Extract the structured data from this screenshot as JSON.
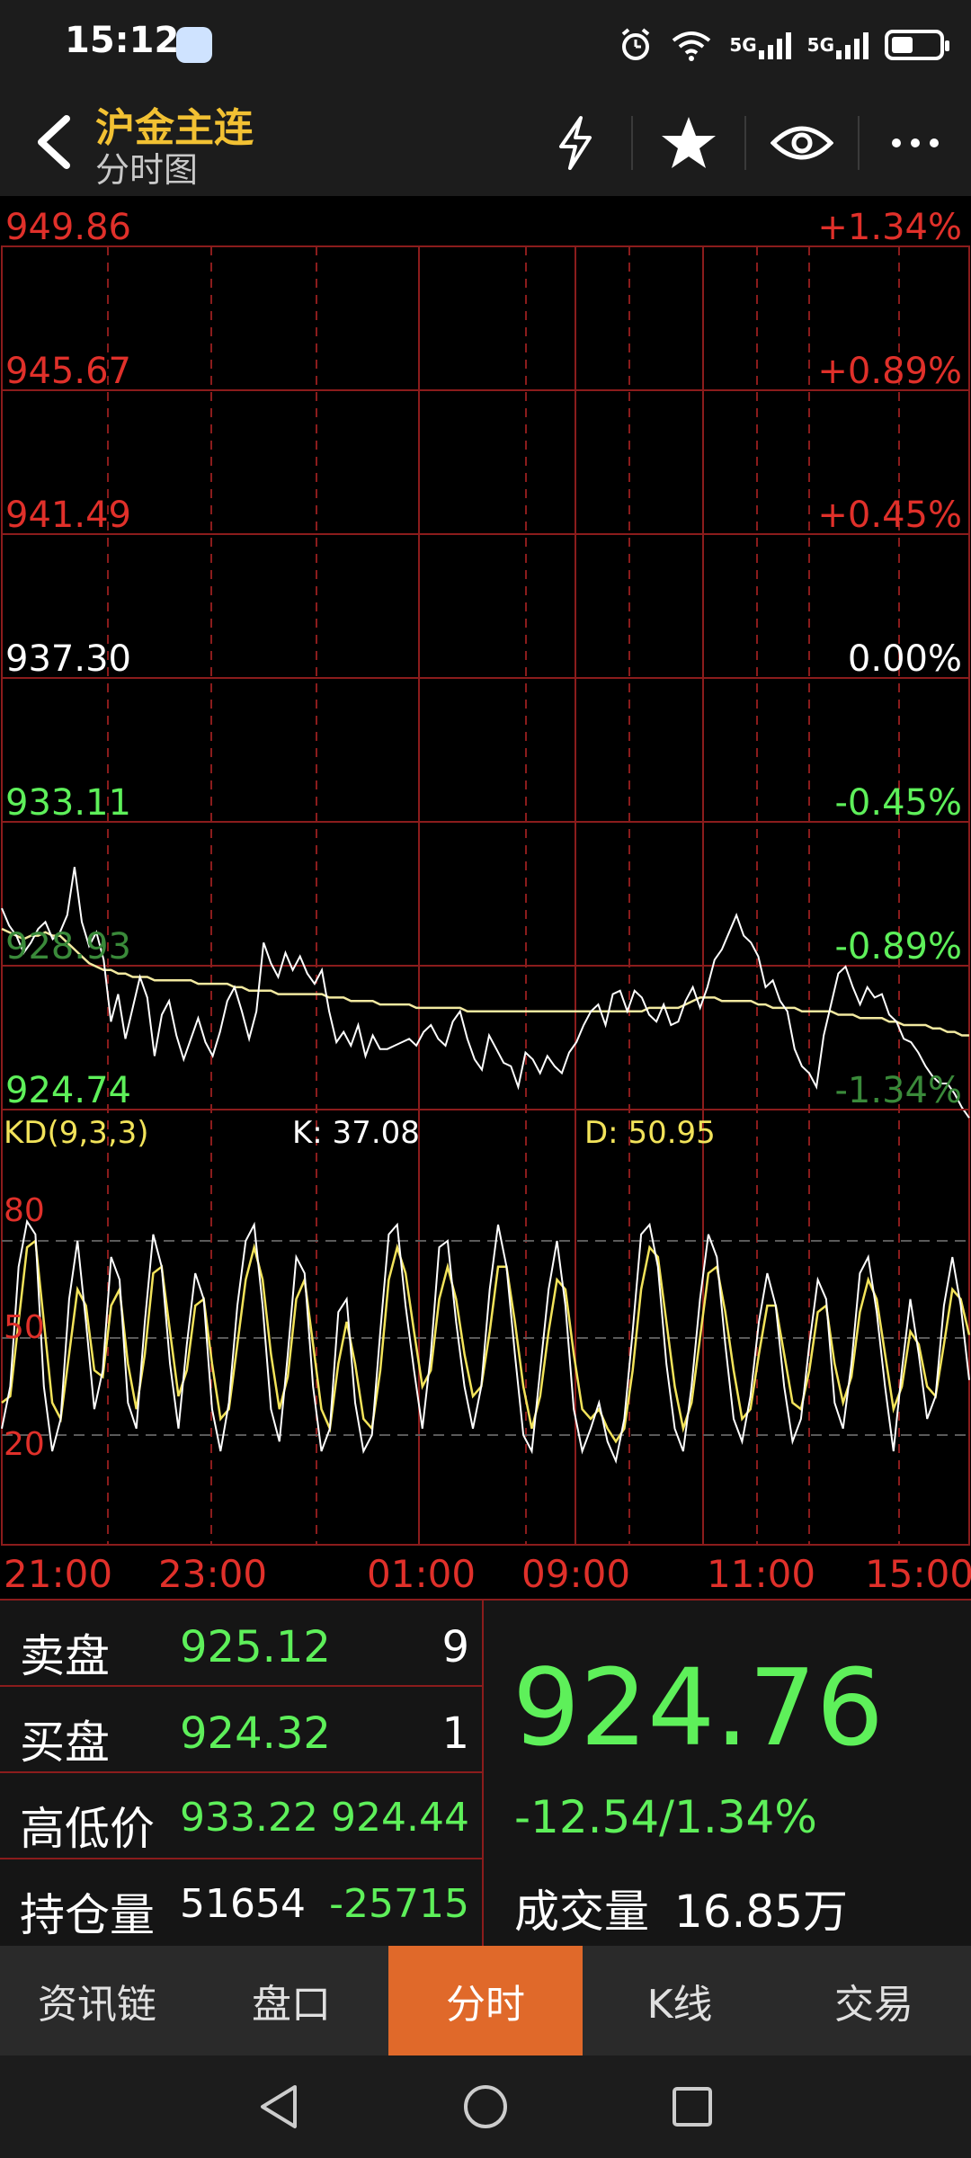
{
  "status_bar": {
    "time": "15:12",
    "net1": "5G",
    "net2": "5G"
  },
  "header": {
    "title": "沪金主连",
    "subtitle": "分时图"
  },
  "chart_data": [
    {
      "type": "line",
      "price_labels": [
        "949.86",
        "945.67",
        "941.49",
        "937.30",
        "933.11",
        "928.93",
        "924.74"
      ],
      "percent_labels": [
        "+1.34%",
        "+0.89%",
        "+0.45%",
        "0.00%",
        "-0.45%",
        "-0.89%",
        "-1.34%"
      ],
      "x_labels": [
        "21:00",
        "23:00",
        "01:00",
        "09:00",
        "11:00",
        "15:00"
      ],
      "ylim": [
        924.74,
        949.86
      ],
      "reference_price": 937.3,
      "series": [
        {
          "values": [
            930.6,
            930.1,
            929.8,
            929.3,
            929.6,
            930.0,
            930.2,
            929.7,
            929.9,
            930.4,
            931.8,
            930.2,
            929.5,
            929.9,
            929.1,
            927.3,
            928.1,
            926.8,
            927.7,
            928.6,
            928.0,
            926.3,
            927.5,
            927.9,
            926.9,
            926.2,
            926.8,
            927.4,
            926.7,
            926.3,
            927.0,
            927.9,
            928.3,
            927.6,
            926.8,
            927.6,
            929.6,
            929.0,
            928.6,
            929.3,
            928.8,
            929.2,
            928.7,
            928.4,
            928.8,
            927.6,
            926.7,
            927.0,
            926.6,
            927.2,
            926.3,
            926.9,
            926.5,
            926.5,
            926.6,
            926.7,
            926.8,
            926.6,
            927.0,
            927.2,
            926.8,
            926.6,
            927.3,
            927.6,
            926.8,
            926.2,
            925.9,
            926.9,
            926.5,
            926.1,
            926.0,
            925.4,
            926.4,
            926.2,
            925.8,
            926.3,
            926.0,
            925.8,
            926.4,
            926.7,
            927.2,
            927.6,
            927.8,
            927.2,
            928.1,
            928.2,
            927.6,
            928.2,
            928.0,
            927.5,
            927.3,
            927.8,
            927.2,
            927.3,
            927.9,
            928.3,
            927.7,
            928.3,
            929.1,
            929.4,
            929.9,
            930.4,
            929.8,
            929.6,
            929.2,
            928.3,
            928.5,
            927.9,
            927.6,
            926.5,
            926.0,
            925.8,
            925.4,
            926.9,
            927.8,
            928.7,
            928.9,
            928.3,
            927.8,
            928.3,
            928.0,
            928.1,
            927.5,
            927.3,
            926.8,
            926.7,
            926.4,
            926.0,
            925.7,
            925.5,
            925.5,
            925.2,
            924.8,
            924.5
          ]
        },
        {
          "values": [
            930.0,
            929.9,
            929.8,
            929.7,
            929.8,
            929.8,
            929.9,
            929.8,
            929.8,
            929.6,
            929.4,
            929.2,
            929.0,
            928.9,
            928.8,
            928.8,
            928.7,
            928.7,
            928.6,
            928.6,
            928.6,
            928.5,
            928.5,
            928.5,
            928.5,
            928.5,
            928.5,
            928.4,
            928.4,
            928.4,
            928.4,
            928.4,
            928.3,
            928.3,
            928.2,
            928.2,
            928.2,
            928.2,
            928.1,
            928.1,
            928.1,
            928.1,
            928.1,
            928.1,
            928.1,
            928.0,
            928.0,
            928.0,
            927.9,
            927.9,
            927.9,
            927.9,
            927.8,
            927.8,
            927.8,
            927.8,
            927.8,
            927.7,
            927.7,
            927.7,
            927.7,
            927.7,
            927.7,
            927.7,
            927.6,
            927.6,
            927.6,
            927.6,
            927.6,
            927.6,
            927.6,
            927.6,
            927.6,
            927.6,
            927.6,
            927.6,
            927.6,
            927.6,
            927.6,
            927.6,
            927.6,
            927.6,
            927.6,
            927.6,
            927.6,
            927.6,
            927.6,
            927.6,
            927.6,
            927.7,
            927.7,
            927.7,
            927.7,
            927.7,
            927.8,
            927.9,
            928.0,
            928.0,
            928.0,
            927.9,
            927.9,
            927.9,
            927.9,
            927.9,
            927.8,
            927.8,
            927.7,
            927.7,
            927.7,
            927.7,
            927.6,
            927.6,
            927.6,
            927.6,
            927.6,
            927.5,
            927.5,
            927.5,
            927.4,
            927.4,
            927.4,
            927.4,
            927.3,
            927.3,
            927.2,
            927.2,
            927.2,
            927.2,
            927.1,
            927.1,
            927.0,
            927.0,
            926.9,
            926.9
          ]
        }
      ]
    },
    {
      "type": "line",
      "title": "KD(9,3,3)",
      "k_label": "K: 37.08",
      "d_label": "D: 50.95",
      "y_ticks": [
        "80",
        "50",
        "20"
      ],
      "ylim": [
        0,
        100
      ],
      "series": [
        {
          "name": "K",
          "values": [
            22,
            35,
            72,
            86,
            82,
            35,
            15,
            25,
            62,
            80,
            55,
            28,
            40,
            75,
            68,
            30,
            22,
            55,
            82,
            72,
            42,
            22,
            48,
            70,
            62,
            28,
            15,
            30,
            60,
            80,
            85,
            60,
            28,
            18,
            45,
            75,
            70,
            35,
            15,
            22,
            58,
            62,
            30,
            15,
            20,
            52,
            82,
            85,
            60,
            40,
            22,
            45,
            78,
            80,
            55,
            35,
            22,
            35,
            65,
            85,
            72,
            45,
            20,
            15,
            40,
            65,
            80,
            60,
            28,
            15,
            22,
            30,
            18,
            12,
            25,
            52,
            82,
            85,
            72,
            42,
            22,
            15,
            35,
            62,
            82,
            75,
            48,
            25,
            18,
            32,
            55,
            70,
            60,
            35,
            18,
            25,
            48,
            68,
            62,
            30,
            22,
            42,
            70,
            75,
            58,
            35,
            15,
            40,
            62,
            45,
            25,
            32,
            60,
            75,
            60,
            37
          ]
        },
        {
          "name": "D",
          "values": [
            30,
            32,
            55,
            78,
            80,
            55,
            30,
            25,
            45,
            65,
            60,
            40,
            38,
            60,
            65,
            42,
            28,
            45,
            70,
            72,
            52,
            32,
            40,
            60,
            62,
            42,
            25,
            28,
            48,
            68,
            78,
            68,
            45,
            28,
            38,
            62,
            68,
            48,
            28,
            22,
            42,
            55,
            42,
            25,
            22,
            40,
            68,
            78,
            70,
            52,
            35,
            40,
            62,
            72,
            62,
            45,
            32,
            35,
            52,
            72,
            72,
            55,
            35,
            22,
            32,
            52,
            68,
            65,
            45,
            28,
            25,
            28,
            22,
            18,
            22,
            40,
            65,
            78,
            75,
            55,
            35,
            22,
            30,
            50,
            70,
            72,
            58,
            40,
            25,
            28,
            45,
            60,
            60,
            45,
            30,
            28,
            40,
            58,
            60,
            42,
            30,
            38,
            58,
            68,
            62,
            45,
            28,
            35,
            52,
            48,
            35,
            32,
            48,
            65,
            62,
            50.95
          ]
        }
      ]
    }
  ],
  "quote": {
    "ask_label": "卖盘",
    "ask_price": "925.12",
    "ask_qty": "9",
    "bid_label": "买盘",
    "bid_price": "924.32",
    "bid_qty": "1",
    "hilo_label": "高低价",
    "high": "933.22",
    "low": "924.44",
    "oi_label": "持仓量",
    "oi": "51654",
    "oi_change": "-25715",
    "last_price": "924.76",
    "change": "-12.54/1.34%",
    "volume_label": "成交量",
    "volume": "16.85万"
  },
  "tabs": [
    {
      "label": "资讯链"
    },
    {
      "label": "盘口"
    },
    {
      "label": "分时",
      "active": true
    },
    {
      "label": "K线"
    },
    {
      "label": "交易"
    }
  ],
  "colors": {
    "up": "#e0302a",
    "down": "#5ef05a",
    "accent": "#f2c133",
    "tab_active": "#e0692a"
  }
}
